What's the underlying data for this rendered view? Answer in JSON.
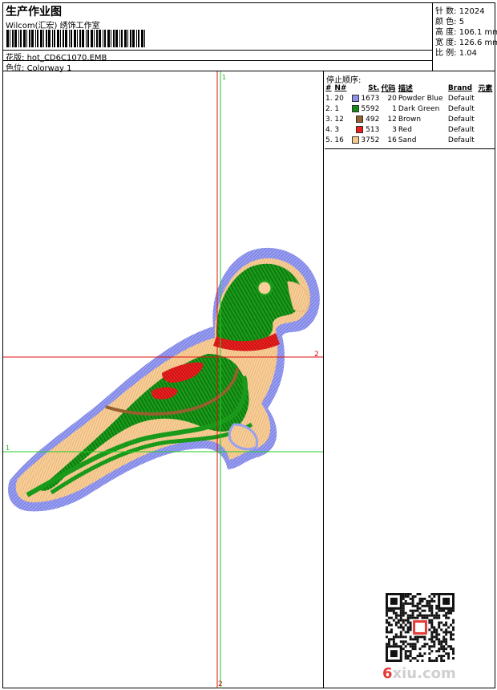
{
  "header": {
    "title": "生产作业图",
    "company": "Wilcom(汇宏) 绣饰工作室",
    "file_label": "花版:",
    "file_name": "hot_CD6C1070.EMB",
    "colorway_label": "色位:",
    "colorway": "Colorway 1"
  },
  "stats": [
    {
      "label": "针 数:",
      "value": "12024"
    },
    {
      "label": "颜 色:",
      "value": "5"
    },
    {
      "label": "高 度:",
      "value": "106.1 mm"
    },
    {
      "label": "宽 度:",
      "value": "126.6 mm"
    },
    {
      "label": "比 例:",
      "value": "1.04"
    }
  ],
  "stop_sequence": {
    "title": "停止顺序:",
    "headers": [
      "#",
      "N#",
      "St.",
      "代码",
      "描述",
      "Brand",
      "元素"
    ],
    "rows": [
      {
        "idx": "1.",
        "n": "20",
        "color": "#8c90ea",
        "st": "1673",
        "code": "20",
        "desc": "Powder Blue",
        "brand": "Default"
      },
      {
        "idx": "2.",
        "n": "1",
        "color": "#168a16",
        "st": "5592",
        "code": "1",
        "desc": "Dark Green",
        "brand": "Default"
      },
      {
        "idx": "3.",
        "n": "12",
        "color": "#93602e",
        "st": "492",
        "code": "12",
        "desc": "Brown",
        "brand": "Default"
      },
      {
        "idx": "4.",
        "n": "3",
        "color": "#ee1c1c",
        "st": "513",
        "code": "3",
        "desc": "Red",
        "brand": "Default"
      },
      {
        "idx": "5.",
        "n": "16",
        "color": "#f8c98c",
        "st": "3752",
        "code": "16",
        "desc": "Sand",
        "brand": "Default"
      }
    ]
  },
  "guides": {
    "marker_1": "1",
    "marker_2": "2"
  },
  "watermark": {
    "six": "6",
    "rest": "xiu.com"
  }
}
